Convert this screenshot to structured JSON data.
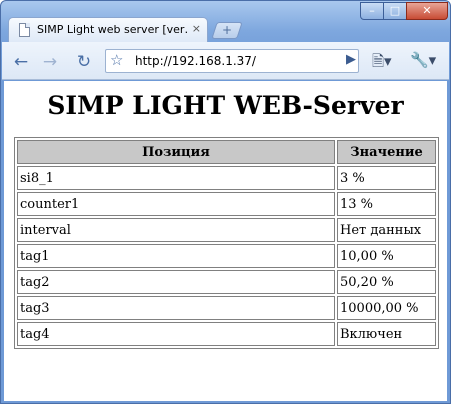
{
  "browser": {
    "tab_title": "SIMP Light web server [ver…",
    "tab_close": "×",
    "new_tab": "+",
    "address": "http://192.168.1.37/",
    "controls": {
      "minimize": "–",
      "maximize": "□",
      "close": "✕"
    }
  },
  "page": {
    "heading": "SIMP LIGHT WEB-Server",
    "table": {
      "headers": [
        "Позиция",
        "Значение"
      ],
      "rows": [
        [
          "si8_1",
          "3 %"
        ],
        [
          "counter1",
          "13 %"
        ],
        [
          "interval",
          "Нет данных"
        ],
        [
          "tag1",
          "10,00 %"
        ],
        [
          "tag2",
          "50,20 %"
        ],
        [
          "tag3",
          "10000,00 %"
        ],
        [
          "tag4",
          "Включен"
        ]
      ]
    }
  }
}
